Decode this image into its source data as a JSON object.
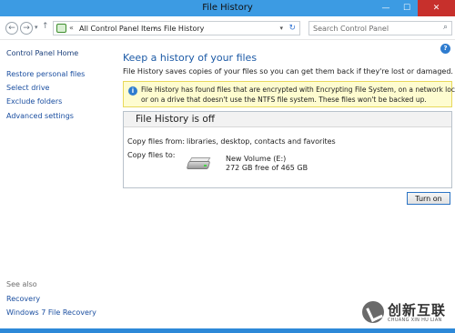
{
  "window": {
    "title": "File History",
    "min_glyph": "—",
    "max_glyph": "☐",
    "close_glyph": "✕"
  },
  "address_bar": {
    "back_glyph": "←",
    "forward_glyph": "→",
    "recent_glyph": "▾",
    "up_glyph": "↑",
    "chevron_glyph": "«",
    "breadcrumbs": [
      "All Control Panel Items",
      "File History"
    ],
    "separator_glyph": "›",
    "dropdown_glyph": "▾",
    "refresh_glyph": "↻"
  },
  "search": {
    "placeholder": "Search Control Panel",
    "icon_glyph": "⌕"
  },
  "help": {
    "glyph": "?"
  },
  "sidebar": {
    "home": "Control Panel Home",
    "items": [
      "Restore personal files",
      "Select drive",
      "Exclude folders",
      "Advanced settings"
    ],
    "see_also": "See also",
    "see_also_items": [
      "Recovery",
      "Windows 7 File Recovery"
    ]
  },
  "main": {
    "heading": "Keep a history of your files",
    "description": "File History saves copies of your files so you can get them back if they're lost or damaged.",
    "notice": {
      "icon_glyph": "i",
      "line1": "File History has found files that are encrypted with Encrypting File System, on a network location,",
      "line2": "or on a drive that doesn't use the NTFS file system. These files won't be backed up."
    },
    "status": {
      "title": "File History is off",
      "copy_from_label": "Copy files from:",
      "copy_from_value": "libraries, desktop, contacts and favorites",
      "copy_to_label": "Copy files to:",
      "drive_name": "New Volume (E:)",
      "drive_space": "272 GB free of 465 GB"
    },
    "turn_on_label": "Turn on"
  },
  "watermark": {
    "cn": "创新互联",
    "en": "CHUANG XIN HU LIAN"
  },
  "colors": {
    "titlebar": "#3c9be3",
    "close": "#c7302c",
    "link": "#1a4ea0",
    "heading": "#1c5aa6",
    "notice_bg": "#fefcd0",
    "statusbar": "#2d89d8"
  }
}
